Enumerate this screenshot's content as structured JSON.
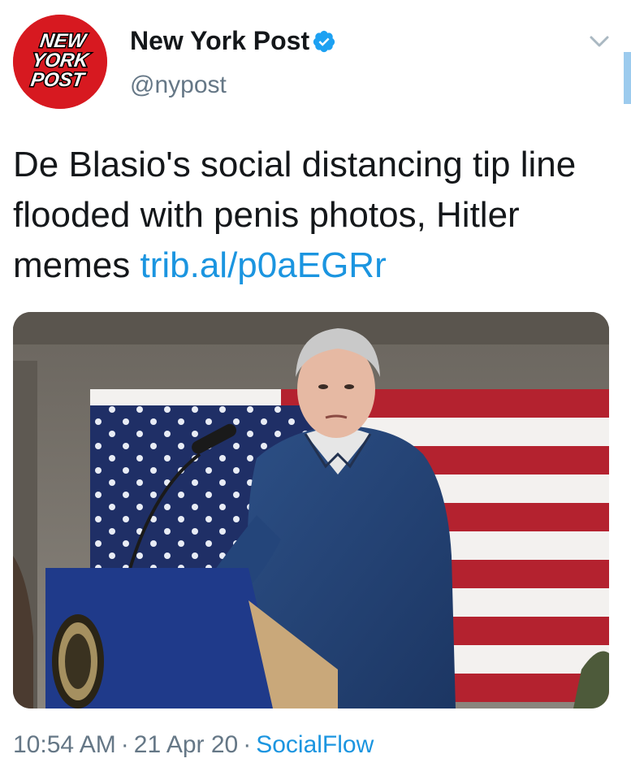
{
  "author": {
    "display_name": "New York Post",
    "handle": "@nypost",
    "verified": true,
    "avatar_logo_lines": [
      "NEW",
      "YORK",
      "POST"
    ],
    "avatar_color": "#d71920"
  },
  "tweet": {
    "text": "De Blasio's social distancing tip line flooded with penis photos, Hitler memes ",
    "link": "trib.al/p0aEGRr"
  },
  "media": {
    "kind": "photo"
  },
  "footer": {
    "time": "10:54 AM",
    "date": "21 Apr 20",
    "separator": "·",
    "source": "SocialFlow"
  },
  "icons": {
    "verified": "verified-badge-icon",
    "menu": "chevron-down-icon"
  },
  "colors": {
    "link_blue": "#1b95e0",
    "secondary_text": "#657786",
    "primary_text": "#14171a"
  }
}
